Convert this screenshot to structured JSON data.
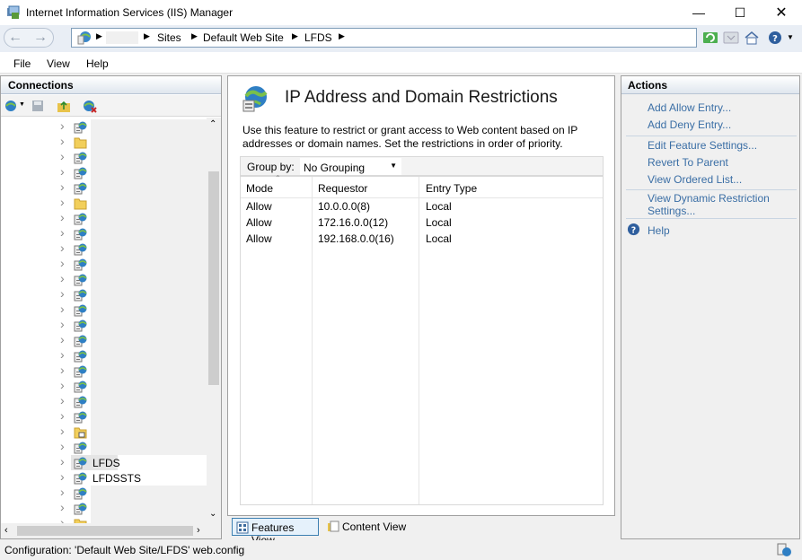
{
  "window": {
    "title": "Internet Information Services (IIS) Manager"
  },
  "breadcrumb": [
    "Sites",
    "Default Web Site",
    "LFDS"
  ],
  "menu": [
    "File",
    "View",
    "Help"
  ],
  "connections": {
    "title": "Connections",
    "tree": [
      {
        "type": "site"
      },
      {
        "type": "folder"
      },
      {
        "type": "site"
      },
      {
        "type": "site"
      },
      {
        "type": "site"
      },
      {
        "type": "folder"
      },
      {
        "type": "site"
      },
      {
        "type": "site"
      },
      {
        "type": "site"
      },
      {
        "type": "site"
      },
      {
        "type": "site"
      },
      {
        "type": "site"
      },
      {
        "type": "site"
      },
      {
        "type": "site"
      },
      {
        "type": "site"
      },
      {
        "type": "site"
      },
      {
        "type": "site"
      },
      {
        "type": "site"
      },
      {
        "type": "site"
      },
      {
        "type": "site"
      },
      {
        "type": "vdir"
      },
      {
        "type": "site"
      },
      {
        "type": "site",
        "label": "LFDS",
        "selected": true
      },
      {
        "type": "site",
        "label": "LFDSSTS"
      },
      {
        "type": "site"
      },
      {
        "type": "site"
      },
      {
        "type": "vdir"
      },
      {
        "type": "site"
      }
    ]
  },
  "feature": {
    "title": "IP Address and Domain Restrictions",
    "description": "Use this feature to restrict or grant access to Web content based on IP addresses or domain names. Set the restrictions in order of priority.",
    "group_by_label": "Group by:",
    "group_by_value": "No Grouping",
    "columns": [
      "Mode",
      "Requestor",
      "Entry Type"
    ],
    "rows": [
      [
        "Allow",
        "10.0.0.0(8)",
        "Local"
      ],
      [
        "Allow",
        "172.16.0.0(12)",
        "Local"
      ],
      [
        "Allow",
        "192.168.0.0(16)",
        "Local"
      ]
    ]
  },
  "view_tabs": {
    "features": "Features View",
    "content": "Content View"
  },
  "actions": {
    "title": "Actions",
    "groups": [
      [
        "Add Allow Entry...",
        "Add Deny Entry..."
      ],
      [
        "Edit Feature Settings...",
        "Revert To Parent",
        "View Ordered List..."
      ],
      [
        "View Dynamic Restriction Settings..."
      ]
    ],
    "help": "Help"
  },
  "status": {
    "text": "Configuration: 'Default Web Site/LFDS' web.config"
  }
}
